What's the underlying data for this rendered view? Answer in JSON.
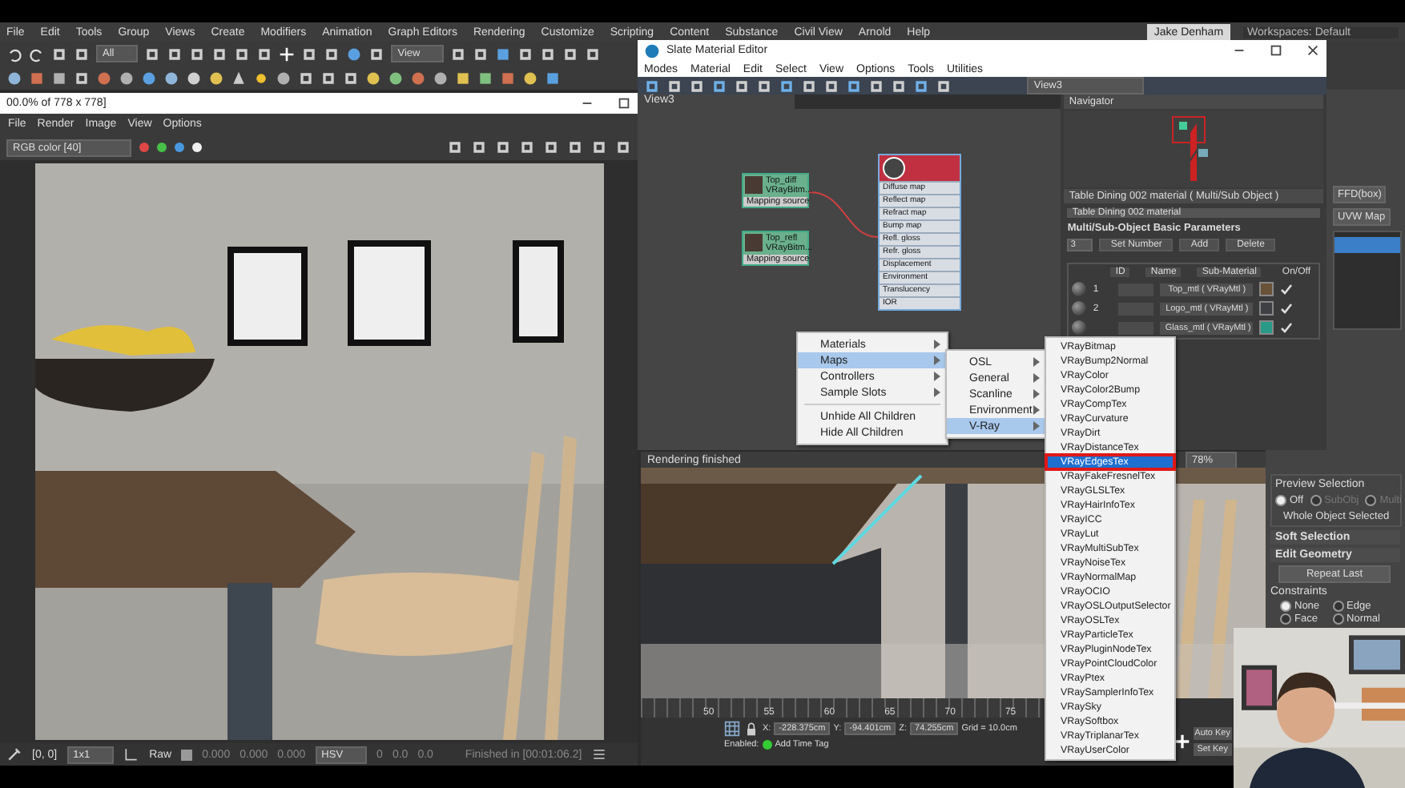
{
  "top_bar": {
    "user": "Jake Denham",
    "workspaces": "Workspaces: Default"
  },
  "menu": [
    "File",
    "Edit",
    "Tools",
    "Group",
    "Views",
    "Create",
    "Modifiers",
    "Animation",
    "Graph Editors",
    "Rendering",
    "Customize",
    "Scripting",
    "Content",
    "Substance",
    "Civil View",
    "Arnold",
    "Help"
  ],
  "toolbar": {
    "selection_filter": "All",
    "reference_coord": "View"
  },
  "frame_buffer": {
    "title": "00.0% of 778 x 778]",
    "menu": [
      "File",
      "Render",
      "Image",
      "View",
      "Options"
    ],
    "channel": "RGB color [40]",
    "channel_dots": [
      {
        "color": "#e04848"
      },
      {
        "color": "#48c048"
      },
      {
        "color": "#4898e0"
      },
      {
        "color": "#f0f0f0"
      }
    ],
    "status": {
      "coords": "[0, 0]",
      "zoom": "1x1",
      "mode": "Raw",
      "rgb": [
        "0.000",
        "0.000",
        "0.000"
      ],
      "color_space": "HSV",
      "hsv": [
        "0",
        "0.0",
        "0.0"
      ],
      "message": "Finished in [00:01:06.2]"
    }
  },
  "slate_editor": {
    "title": "Slate Material Editor",
    "menu": [
      "Modes",
      "Material",
      "Edit",
      "Select",
      "View",
      "Options",
      "Tools",
      "Utilities"
    ],
    "view_dropdown": "View3",
    "view_tab": "View3",
    "navigator": "Navigator",
    "nodes": [
      {
        "title": "Top_diff",
        "subtitle": "VRayBitm...",
        "slot": "Mapping source"
      },
      {
        "title": "Top_refl",
        "subtitle": "VRayBitm...",
        "slot": "Mapping source"
      }
    ],
    "material_node": {
      "slots": [
        "Diffuse map",
        "Reflect map",
        "Refract map",
        "Bump map",
        "Refl. gloss",
        "Refr. gloss",
        "Displacement",
        "Environment",
        "Translucency",
        "IOR"
      ]
    },
    "params": {
      "title": "Table Dining 002 material  ( Multi/Sub Object )",
      "name": "Table Dining 002 material",
      "rollout": "Multi/Sub-Object Basic Parameters",
      "count": "3",
      "buttons": [
        "Set Number",
        "Add",
        "Delete"
      ],
      "columns": [
        "ID",
        "Name",
        "Sub-Material",
        "On/Off"
      ],
      "rows": [
        {
          "id": "1",
          "material": "Top_mtl ( VRayMtl )",
          "color": "#6a5238",
          "on": true
        },
        {
          "id": "2",
          "material": "Logo_mtl ( VRayMtl )",
          "color": "#3e4044",
          "on": true
        },
        {
          "material": "Glass_mtl ( VRayMtl )",
          "color": "#2a9a88",
          "on": true
        }
      ]
    }
  },
  "context_menu": {
    "items": [
      {
        "kind": "submenu",
        "label": "Materials",
        "selected": false
      },
      {
        "kind": "submenu",
        "label": "Maps",
        "selected": true
      },
      {
        "kind": "submenu",
        "label": "Controllers",
        "selected": false
      },
      {
        "kind": "submenu",
        "label": "Sample Slots",
        "selected": false
      },
      {
        "kind": "separator"
      },
      {
        "kind": "command",
        "label": "Unhide All Children",
        "selected": false
      },
      {
        "kind": "command",
        "label": "Hide All Children",
        "selected": false
      }
    ]
  },
  "submenu": {
    "items": [
      {
        "label": "OSL",
        "selected": false
      },
      {
        "label": "General",
        "selected": false
      },
      {
        "label": "Scanline",
        "selected": false
      },
      {
        "label": "Environment",
        "selected": false
      },
      {
        "label": "V-Ray",
        "selected": true
      }
    ]
  },
  "vray_maps": {
    "items": [
      {
        "label": "VRayBitmap",
        "selected": false
      },
      {
        "label": "VRayBump2Normal",
        "selected": false
      },
      {
        "label": "VRayColor",
        "selected": false
      },
      {
        "label": "VRayColor2Bump",
        "selected": false
      },
      {
        "label": "VRayCompTex",
        "selected": false
      },
      {
        "label": "VRayCurvature",
        "selected": false
      },
      {
        "label": "VRayDirt",
        "selected": false
      },
      {
        "label": "VRayDistanceTex",
        "selected": false
      },
      {
        "label": "VRayEdgesTex",
        "selected": true
      },
      {
        "label": "VRayFakeFresnelTex",
        "selected": false
      },
      {
        "label": "VRayGLSLTex",
        "selected": false
      },
      {
        "label": "VRayHairInfoTex",
        "selected": false
      },
      {
        "label": "VRayICC",
        "selected": false
      },
      {
        "label": "VRayLut",
        "selected": false
      },
      {
        "label": "VRayMultiSubTex",
        "selected": false
      },
      {
        "label": "VRayNoiseTex",
        "selected": false
      },
      {
        "label": "VRayNormalMap",
        "selected": false
      },
      {
        "label": "VRayOCIO",
        "selected": false
      },
      {
        "label": "VRayOSLOutputSelector",
        "selected": false
      },
      {
        "label": "VRayOSLTex",
        "selected": false
      },
      {
        "label": "VRayParticleTex",
        "selected": false
      },
      {
        "label": "VRayPluginNodeTex",
        "selected": false
      },
      {
        "label": "VRayPointCloudColor",
        "selected": false
      },
      {
        "label": "VRayPtex",
        "selected": false
      },
      {
        "label": "VRaySamplerInfoTex",
        "selected": false
      },
      {
        "label": "VRaySky",
        "selected": false
      },
      {
        "label": "VRaySoftbox",
        "selected": false
      },
      {
        "label": "VRayTriplanarTex",
        "selected": false
      },
      {
        "label": "VRayUserColor",
        "selected": false
      }
    ]
  },
  "rendering": {
    "title": "Rendering finished",
    "zoom": "78%"
  },
  "timeline": {
    "ticks": [
      "50",
      "55",
      "60",
      "65",
      "70",
      "75"
    ],
    "coords": [
      {
        "label": "X:",
        "value": "-228.375cm"
      },
      {
        "label": "Y:",
        "value": "-94.401cm"
      },
      {
        "label": "Z:",
        "value": "74.255cm"
      }
    ],
    "grid": "Grid = 10.0cm",
    "enabled": "Enabled:",
    "add_time_tag": "Add Time Tag",
    "auto_key": "Auto Key",
    "set_key": "Set Key"
  },
  "command_panel": {
    "modifiers": [
      "FFD(box)",
      "UVW Map"
    ],
    "preview_title": "Preview Selection",
    "preview_options": [
      {
        "label": "Off",
        "selected": true,
        "disabled": false
      },
      {
        "label": "SubObj",
        "selected": false,
        "disabled": true
      },
      {
        "label": "Multi",
        "selected": false,
        "disabled": true
      }
    ],
    "status": "Whole Object Selected",
    "soft_selection": "Soft Selection",
    "edit_geometry": "Edit Geometry",
    "repeat_last": "Repeat Last",
    "constraints_title": "Constraints",
    "constraints": [
      {
        "label": "None",
        "selected": true
      },
      {
        "label": "Edge",
        "selected": false
      },
      {
        "label": "Face",
        "selected": false
      },
      {
        "label": "Normal",
        "selected": false
      }
    ]
  }
}
